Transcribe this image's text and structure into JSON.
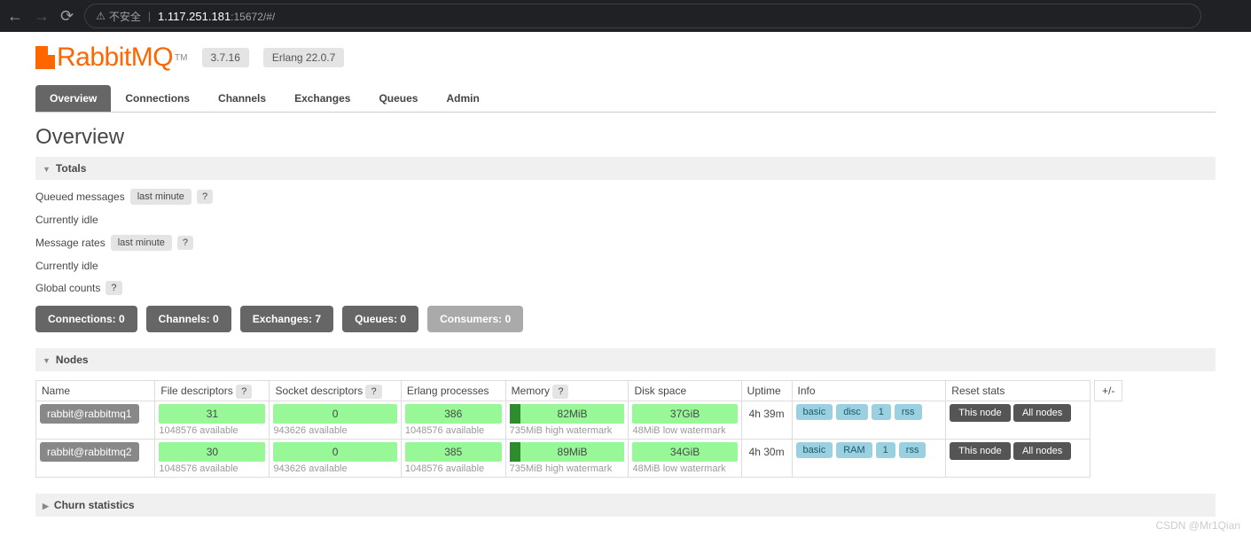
{
  "browser": {
    "insecure_label": "不安全",
    "url_host": "1.117.251.181",
    "url_port": ":15672",
    "url_path": "/#/"
  },
  "header": {
    "logo_text": "RabbitMQ",
    "version": "3.7.16",
    "erlang": "Erlang 22.0.7"
  },
  "tabs": [
    "Overview",
    "Connections",
    "Channels",
    "Exchanges",
    "Queues",
    "Admin"
  ],
  "page_title": "Overview",
  "sections": {
    "totals": "Totals",
    "nodes": "Nodes",
    "churn": "Churn statistics"
  },
  "totals": {
    "queued_label": "Queued messages",
    "last_minute": "last minute",
    "idle1": "Currently idle",
    "rates_label": "Message rates",
    "idle2": "Currently idle",
    "global_label": "Global counts",
    "help": "?"
  },
  "counts": [
    {
      "label": "Connections:",
      "val": "0"
    },
    {
      "label": "Channels:",
      "val": "0"
    },
    {
      "label": "Exchanges:",
      "val": "7"
    },
    {
      "label": "Queues:",
      "val": "0"
    },
    {
      "label": "Consumers:",
      "val": "0",
      "dim": true
    }
  ],
  "nodes_headers": [
    "Name",
    "File descriptors",
    "Socket descriptors",
    "Erlang processes",
    "Memory",
    "Disk space",
    "Uptime",
    "Info",
    "Reset stats"
  ],
  "plus_minus": "+/-",
  "nodes": [
    {
      "name": "rabbit@rabbitmq1",
      "fd": "31",
      "fd_sub": "1048576 available",
      "sd": "0",
      "sd_sub": "943626 available",
      "ep": "386",
      "ep_sub": "1048576 available",
      "mem": "82MiB",
      "mem_sub": "735MiB high watermark",
      "disk": "37GiB",
      "disk_sub": "48MiB low watermark",
      "uptime": "4h 39m",
      "info": [
        "basic",
        "disc",
        "1",
        "rss"
      ]
    },
    {
      "name": "rabbit@rabbitmq2",
      "fd": "30",
      "fd_sub": "1048576 available",
      "sd": "0",
      "sd_sub": "943626 available",
      "ep": "385",
      "ep_sub": "1048576 available",
      "mem": "89MiB",
      "mem_sub": "735MiB high watermark",
      "disk": "34GiB",
      "disk_sub": "48MiB low watermark",
      "uptime": "4h 30m",
      "info": [
        "basic",
        "RAM",
        "1",
        "rss"
      ]
    }
  ],
  "reset": {
    "this": "This node",
    "all": "All nodes"
  },
  "watermark": "CSDN @Mr1Qian"
}
